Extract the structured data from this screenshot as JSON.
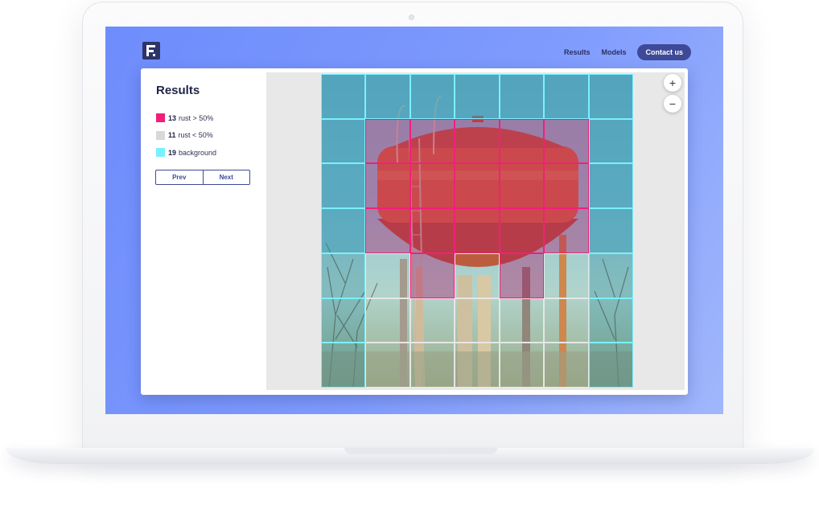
{
  "nav": {
    "links": [
      "Results",
      "Models"
    ],
    "contact_label": "Contact us"
  },
  "sidebar": {
    "title": "Results",
    "legend": [
      {
        "count": "13",
        "label": "rust > 50%",
        "color": "#f0207a"
      },
      {
        "count": "11",
        "label": "rust < 50%",
        "color": "#d8d8d8"
      },
      {
        "count": "19",
        "label": "background",
        "color": "#79f1ff"
      }
    ],
    "prev_label": "Prev",
    "next_label": "Next"
  },
  "zoom": {
    "in_label": "+",
    "out_label": "−"
  },
  "grid_classes": [
    [
      "bg",
      "bg",
      "bg",
      "bg",
      "bg",
      "bg",
      "bg"
    ],
    [
      "bg",
      "rh",
      "rh",
      "rh",
      "rh",
      "rh",
      "bg"
    ],
    [
      "bg",
      "rh",
      "rh",
      "rh",
      "rh",
      "rh",
      "bg"
    ],
    [
      "bg",
      "rh",
      "rh",
      "rh",
      "rh",
      "rh",
      "bg"
    ],
    [
      "bg",
      "rl",
      "rh",
      "rl",
      "rh",
      "rl",
      "bg"
    ],
    [
      "bg",
      "rl",
      "rl",
      "rl",
      "rl",
      "rl",
      "bg"
    ],
    [
      "bg",
      "rl",
      "rl",
      "rl",
      "rl",
      "rl",
      "bg"
    ]
  ],
  "icons": {
    "logo": "brand-logo-icon",
    "zoom_in": "zoom-in-icon",
    "zoom_out": "zoom-out-icon"
  }
}
